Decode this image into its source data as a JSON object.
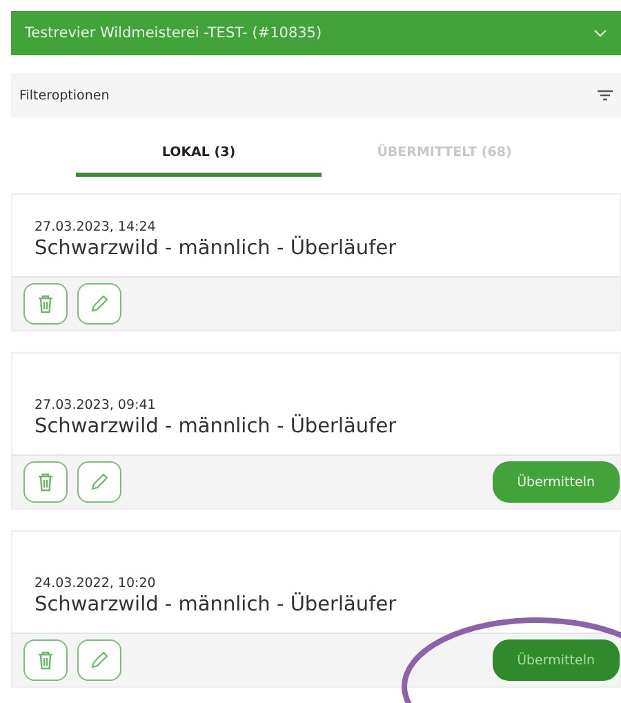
{
  "header": {
    "title": "Testrevier Wildmeisterei -TEST- (#10835)"
  },
  "filter": {
    "label": "Filteroptionen"
  },
  "tabs": [
    {
      "label": "LOKAL (3)",
      "selected": true
    },
    {
      "label": "ÜBERMITTELT (68)",
      "selected": false
    }
  ],
  "entries": [
    {
      "timestamp": "27.03.2023, 14:24",
      "title": "Schwarzwild - männlich - Überläufer"
    },
    {
      "timestamp": "27.03.2023, 09:41",
      "title": "Schwarzwild - männlich - Überläufer",
      "submit": {
        "label": "Übermitteln",
        "disabled": false
      }
    },
    {
      "timestamp": "24.03.2022, 10:20",
      "title": "Schwarzwild - männlich - Überläufer",
      "submit": {
        "label": "Übermitteln",
        "disabled": true
      },
      "circled": true
    }
  ]
}
